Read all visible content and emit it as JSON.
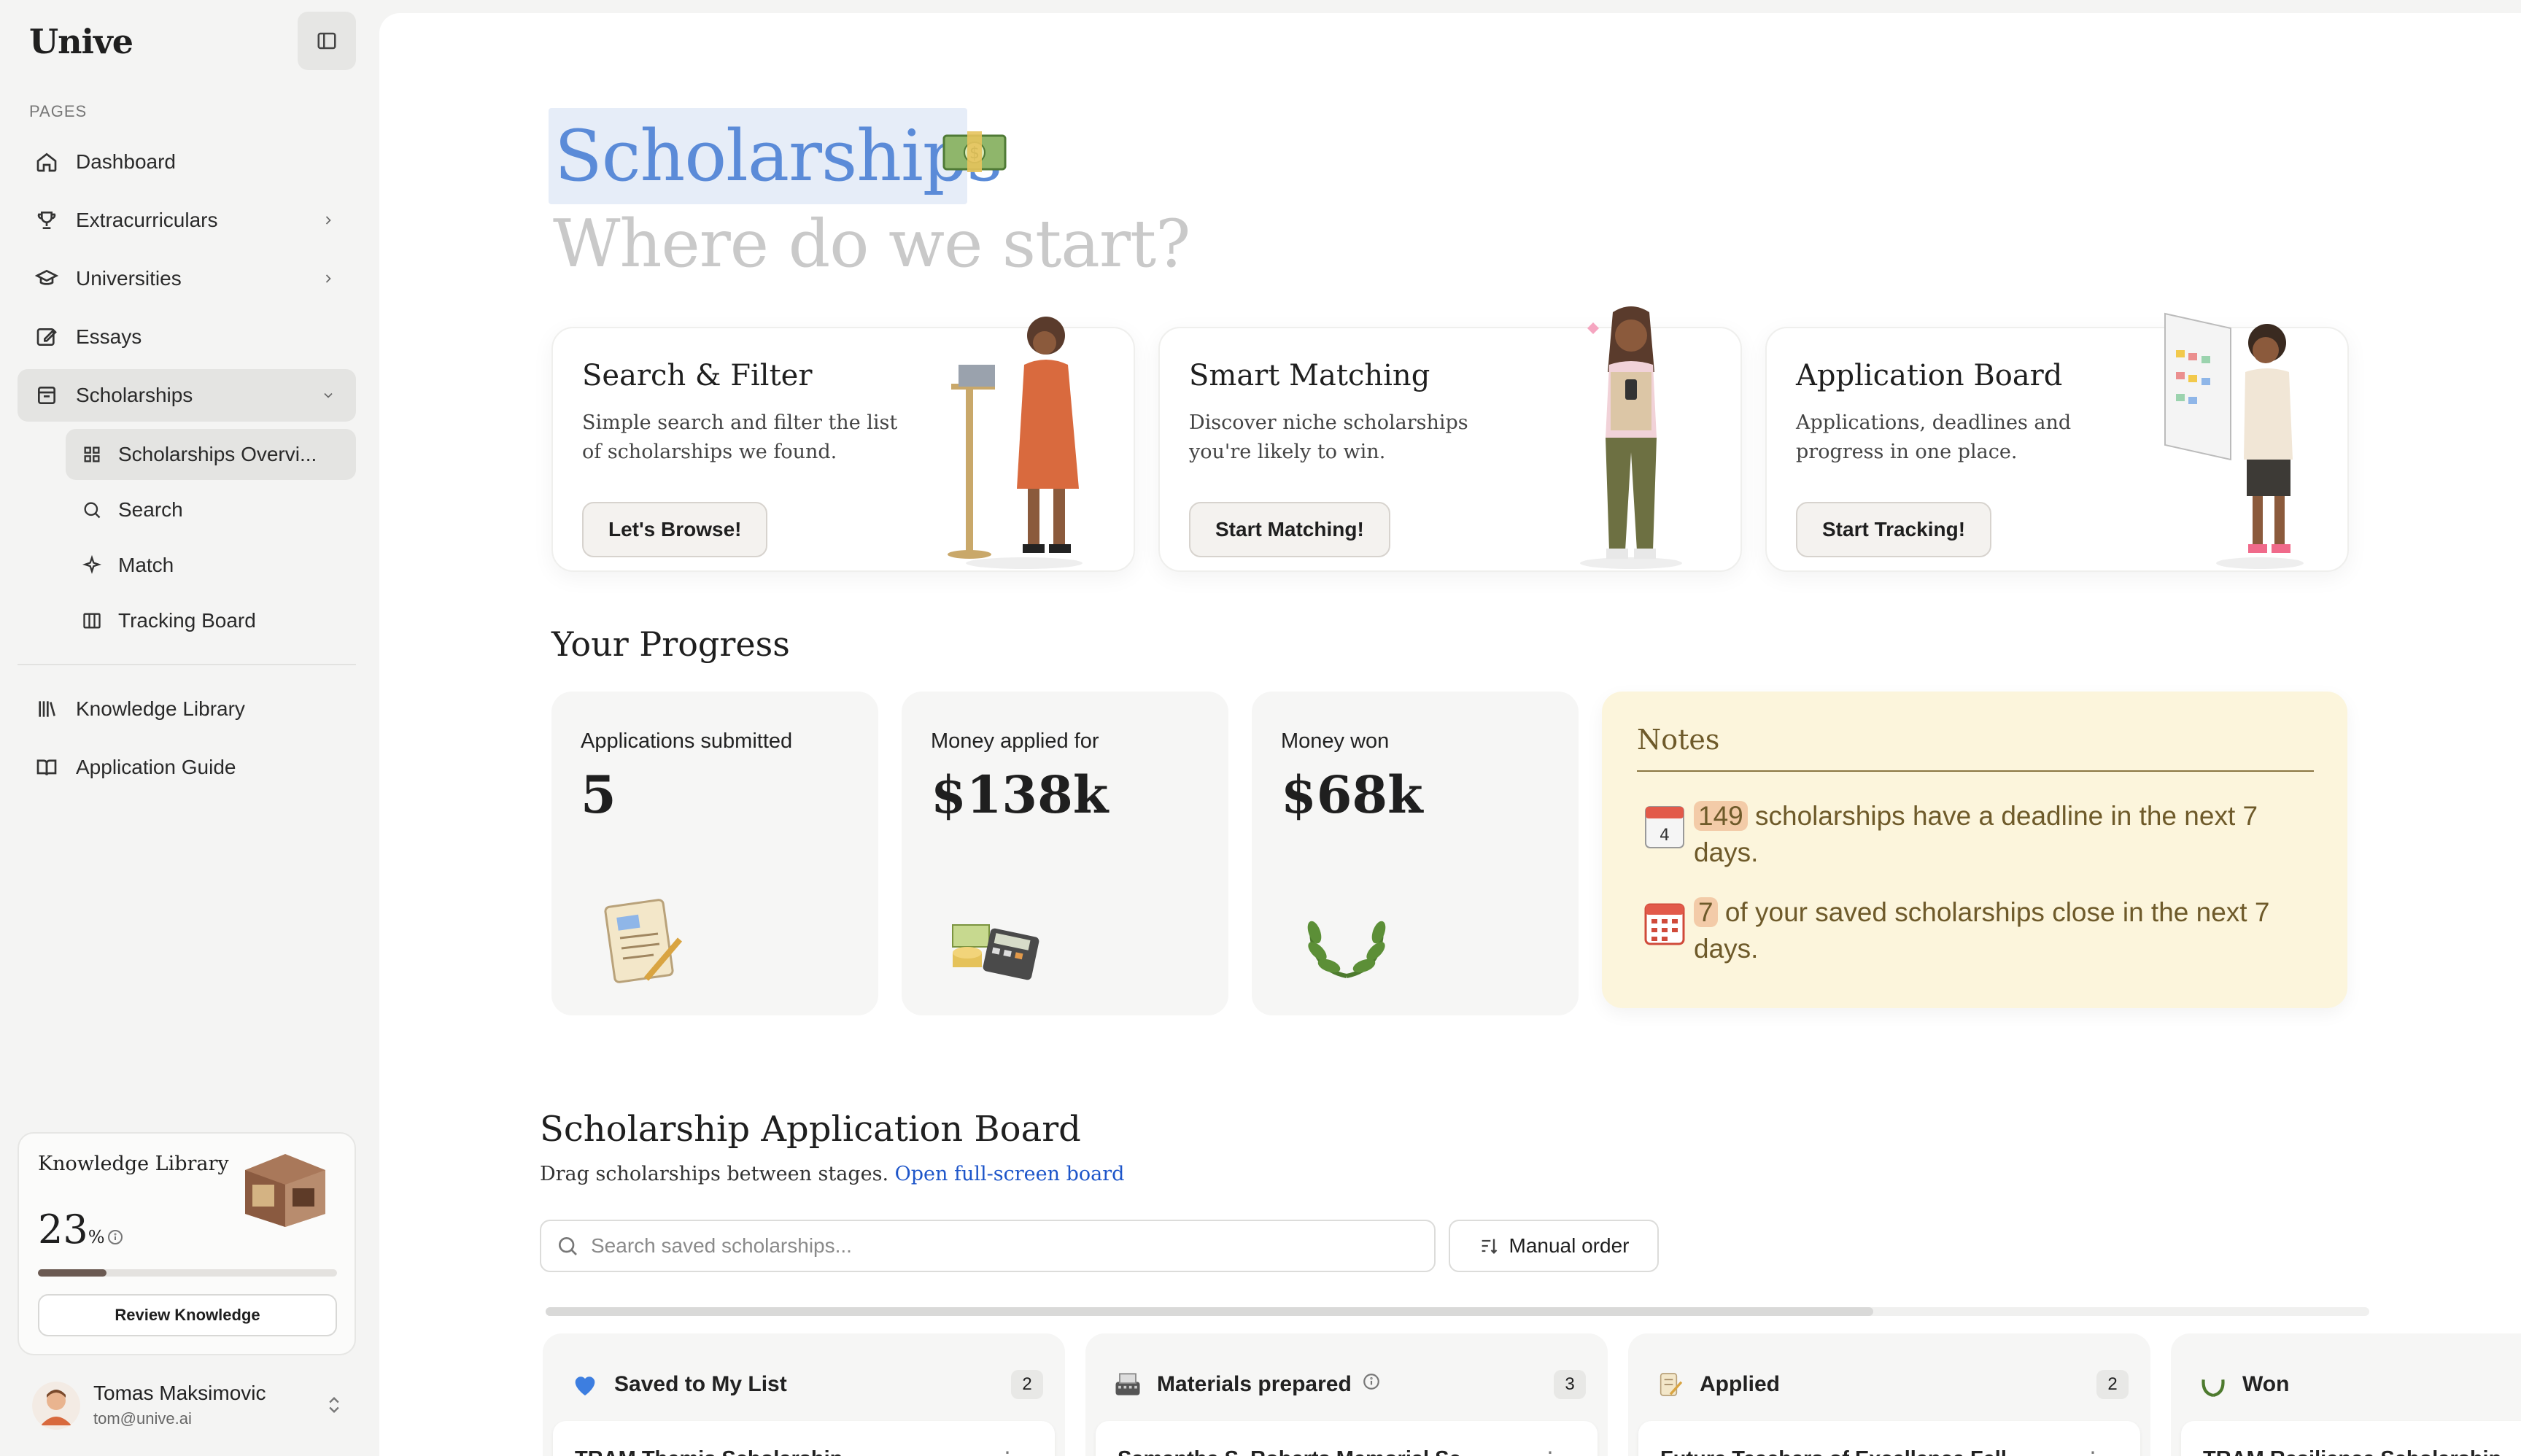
{
  "sidebar": {
    "brand": "Unive",
    "section_label": "PAGES",
    "items": [
      {
        "label": "Dashboard"
      },
      {
        "label": "Extracurriculars"
      },
      {
        "label": "Universities"
      },
      {
        "label": "Essays"
      },
      {
        "label": "Scholarships"
      }
    ],
    "sub_items": [
      {
        "label": "Scholarships Overvi..."
      },
      {
        "label": "Search"
      },
      {
        "label": "Match"
      },
      {
        "label": "Tracking Board"
      }
    ],
    "lower_items": [
      {
        "label": "Knowledge Library"
      },
      {
        "label": "Application Guide"
      }
    ],
    "knowledge_card": {
      "title": "Knowledge Library",
      "percent": "23",
      "percent_unit": "%",
      "progress": 0.23,
      "button": "Review Knowledge"
    },
    "user": {
      "name": "Tomas Maksimovic",
      "email": "tom@unive.ai"
    }
  },
  "header": {
    "title": "Scholarships",
    "subtitle": "Where do we start?"
  },
  "features": [
    {
      "title": "Search & Filter",
      "desc": "Simple search and filter the list of scholarships we found.",
      "button": "Let's Browse!"
    },
    {
      "title": "Smart Matching",
      "desc": "Discover niche scholarships you're likely to win.",
      "button": "Start Matching!"
    },
    {
      "title": "Application Board",
      "desc": "Applications, deadlines and progress in one place.",
      "button": "Start Tracking!"
    }
  ],
  "progress": {
    "title": "Your Progress",
    "stats": [
      {
        "label": "Applications submitted",
        "value": "5"
      },
      {
        "label": "Money applied for",
        "value": "$138k"
      },
      {
        "label": "Money won",
        "value": "$68k"
      }
    ]
  },
  "notes": {
    "title": "Notes",
    "lines": [
      {
        "num": "149",
        "text": " scholarships have a deadline in the next 7 days."
      },
      {
        "num": "7",
        "text": " of your saved scholarships close in the next 7 days."
      }
    ],
    "calendar_day": "4"
  },
  "board": {
    "title": "Scholarship Application Board",
    "subtitle": "Drag scholarships between stages. ",
    "link": "Open full-screen board",
    "search_placeholder": "Search saved scholarships...",
    "order_button": "Manual order",
    "columns": [
      {
        "title": "Saved to My List",
        "count": "2",
        "first_card": "TRAM Themis Scholarship"
      },
      {
        "title": "Materials prepared",
        "count": "3",
        "first_card": "Samantha S. Roberts Memorial Sc..."
      },
      {
        "title": "Applied",
        "count": "2",
        "first_card": "Future Teachers of Excellence Fell..."
      },
      {
        "title": "Won",
        "count": "",
        "first_card": "TRAM Resilience Scholarship"
      }
    ]
  },
  "colors": {
    "accent_blue": "#5b8bd8",
    "notes_bg": "#fcf5dc",
    "link": "#1d55c9"
  }
}
